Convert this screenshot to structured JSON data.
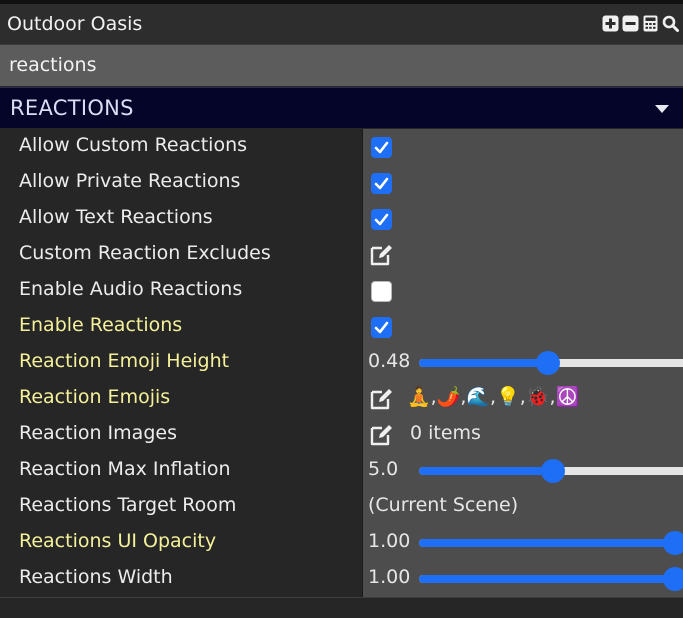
{
  "window": {
    "title": "Outdoor Oasis",
    "icons": [
      "plus-box-icon",
      "minus-box-icon",
      "calculator-icon",
      "search-icon"
    ]
  },
  "search": {
    "value": "reactions"
  },
  "section": {
    "title": "REACTIONS"
  },
  "colors": {
    "accent": "#1e6ff5",
    "highlight_label": "#f4f19a",
    "section_bg": "#05052a"
  },
  "rows": [
    {
      "label": "Allow Custom Reactions",
      "highlight": false,
      "control": "checkbox",
      "checked": true
    },
    {
      "label": "Allow Private Reactions",
      "highlight": false,
      "control": "checkbox",
      "checked": true
    },
    {
      "label": "Allow Text Reactions",
      "highlight": false,
      "control": "checkbox",
      "checked": true
    },
    {
      "label": "Custom Reaction Excludes",
      "highlight": false,
      "control": "edit"
    },
    {
      "label": "Enable Audio Reactions",
      "highlight": false,
      "control": "checkbox",
      "checked": false
    },
    {
      "label": "Enable Reactions",
      "highlight": true,
      "control": "checkbox",
      "checked": true
    },
    {
      "label": "Reaction Emoji Height",
      "highlight": true,
      "control": "slider",
      "value_text": "0.48",
      "fraction": 0.48
    },
    {
      "label": "Reaction Emojis",
      "highlight": true,
      "control": "edit-emojis",
      "emojis": "🧘,🌶️,🌊,💡,🐞,☮️"
    },
    {
      "label": "Reaction Images",
      "highlight": false,
      "control": "edit-items",
      "items_text": "0 items"
    },
    {
      "label": "Reaction Max Inflation",
      "highlight": false,
      "control": "slider",
      "value_text": "5.0",
      "fraction": 0.5
    },
    {
      "label": "Reactions Target Room",
      "highlight": false,
      "control": "text",
      "value_text": "(Current Scene)"
    },
    {
      "label": "Reactions UI Opacity",
      "highlight": true,
      "control": "slider",
      "value_text": "1.00",
      "fraction": 1.0
    },
    {
      "label": "Reactions Width",
      "highlight": false,
      "control": "slider",
      "value_text": "1.00",
      "fraction": 1.0
    }
  ]
}
